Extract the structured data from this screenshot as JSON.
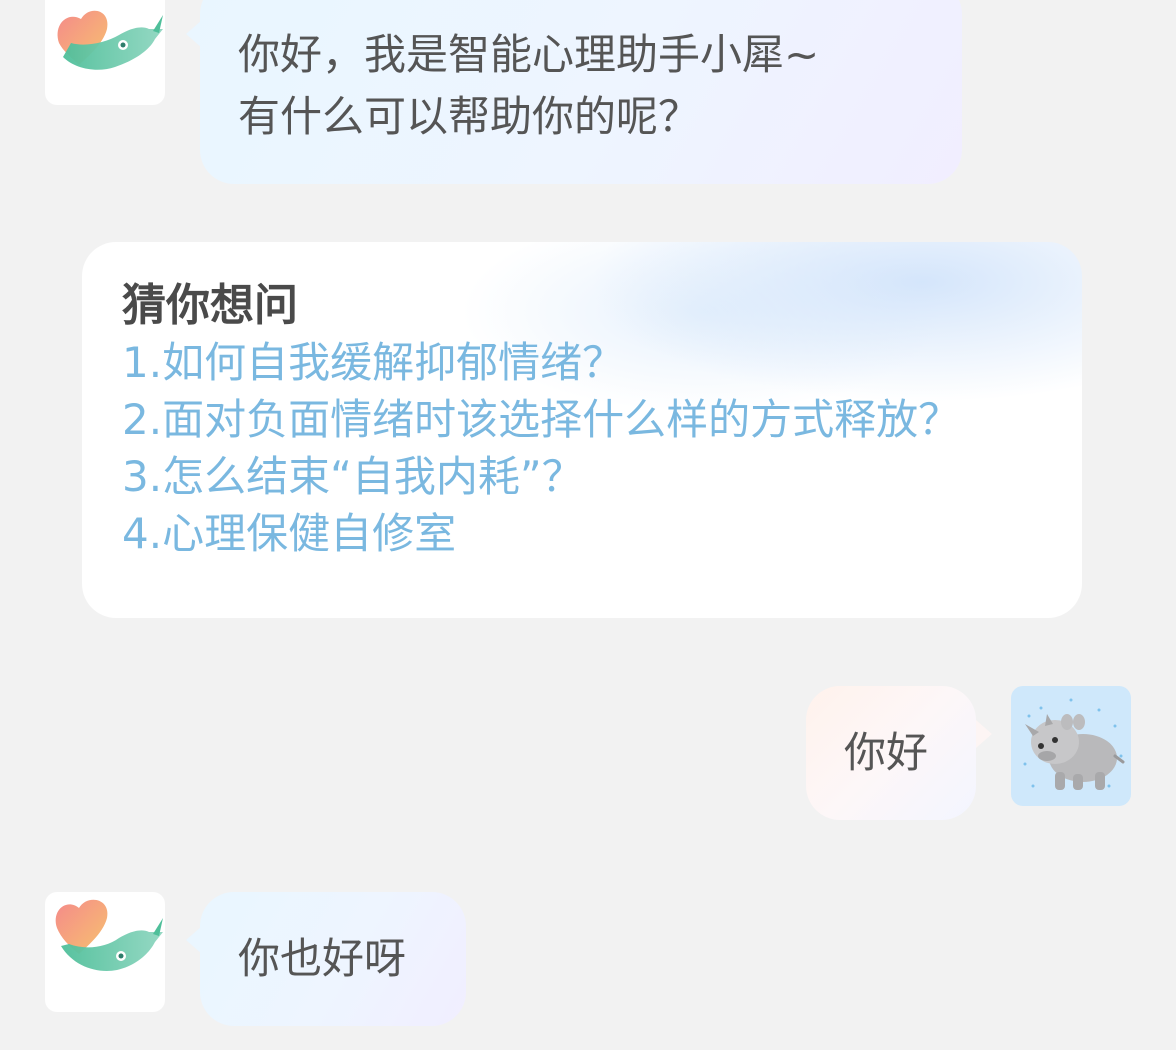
{
  "messages": [
    {
      "sender": "assistant",
      "lines": [
        "你好，我是智能心理助手小犀~",
        "有什么可以帮助你的呢？"
      ]
    },
    {
      "sender": "user",
      "text": "你好"
    },
    {
      "sender": "assistant",
      "text": "你也好呀"
    }
  ],
  "suggestions": {
    "title": "猜你想问",
    "items": [
      "1.如何自我缓解抑郁情绪？",
      "2.面对负面情绪时该选择什么样的方式释放？",
      "3.怎么结束“自我内耗”？",
      "4.心理保健自修室"
    ]
  },
  "avatars": {
    "assistant_icon": "heart-rhino-logo-icon",
    "user_icon": "rhino-sticker-icon"
  },
  "colors": {
    "background": "#f2f2f2",
    "suggestion_link": "#7ab8e0",
    "bubble_text": "#555555",
    "user_avatar_bg": "#cfe8fb"
  }
}
